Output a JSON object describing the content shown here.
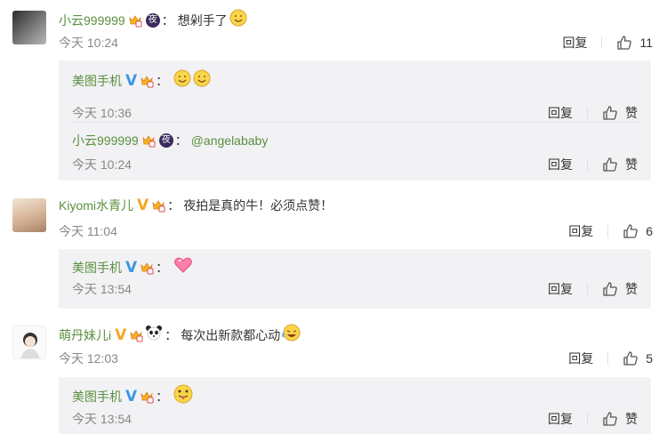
{
  "comments": [
    {
      "user": "小云999999",
      "text": "想剁手了",
      "time": "今天 10:24",
      "reply_label": "回复",
      "like_count": "11",
      "replies": [
        {
          "user": "美图手机",
          "text": "",
          "time": "今天 10:36",
          "reply_label": "回复",
          "like_label": "赞"
        },
        {
          "user": "小云999999",
          "text": "@angelababy",
          "time": "今天 10:24",
          "reply_label": "回复",
          "like_label": "赞"
        }
      ]
    },
    {
      "user": "Kiyomi水青儿",
      "text": "夜拍是真的牛！必须点赞！",
      "time": "今天 11:04",
      "reply_label": "回复",
      "like_count": "6",
      "replies": [
        {
          "user": "美图手机",
          "text": "",
          "time": "今天 13:54",
          "reply_label": "回复",
          "like_label": "赞"
        }
      ]
    },
    {
      "user": "萌丹妹儿i",
      "text": "每次出新款都心动",
      "time": "今天 12:03",
      "reply_label": "回复",
      "like_count": "5",
      "replies": [
        {
          "user": "美图手机",
          "text": "",
          "time": "今天 13:54",
          "reply_label": "回复",
          "like_label": "赞"
        }
      ]
    }
  ],
  "colors": {
    "username": "#5a8f3c",
    "reply_bg": "#f2f2f5",
    "meta": "#888888",
    "verified_blue": "#3c98e6",
    "verified_gold": "#f5a623"
  },
  "icons": [
    "crown-badge-icon",
    "night-badge-icon",
    "verified-v-icon",
    "thumbs-up-icon",
    "panda-icon",
    "smile-emoji-icon",
    "heart-emoji-icon",
    "laugh-emoji-icon",
    "tongue-emoji-icon"
  ]
}
